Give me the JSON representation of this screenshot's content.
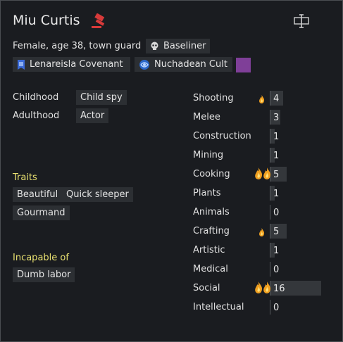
{
  "pawn": {
    "name": "Miu Curtis",
    "description": "Female, age 38, town guard",
    "xenotype": "Baseliner"
  },
  "factions": [
    {
      "label": "Lenareisla Covenant",
      "icon": "faction-banner-icon"
    },
    {
      "label": "Nuchadean Cult",
      "icon": "ideoligion-icon"
    }
  ],
  "ideo_color": "#7f3f98",
  "backstory": {
    "childhood_label": "Childhood",
    "childhood": "Child spy",
    "adulthood_label": "Adulthood",
    "adulthood": "Actor"
  },
  "traits": {
    "heading": "Traits",
    "items": [
      "Beautiful",
      "Quick sleeper",
      "Gourmand"
    ]
  },
  "incapable": {
    "heading": "Incapable of",
    "items": [
      "Dumb labor"
    ]
  },
  "skills": [
    {
      "name": "Shooting",
      "level": "4",
      "passion": 1,
      "fill": 0.2
    },
    {
      "name": "Melee",
      "level": "3",
      "passion": 0,
      "fill": 0.15
    },
    {
      "name": "Construction",
      "level": "1",
      "passion": 0,
      "fill": 0.05
    },
    {
      "name": "Mining",
      "level": "1",
      "passion": 0,
      "fill": 0.05
    },
    {
      "name": "Cooking",
      "level": "5",
      "passion": 2,
      "fill": 0.25
    },
    {
      "name": "Plants",
      "level": "1",
      "passion": 0,
      "fill": 0.05
    },
    {
      "name": "Animals",
      "level": "0",
      "passion": 0,
      "fill": 0
    },
    {
      "name": "Crafting",
      "level": "5",
      "passion": 1,
      "fill": 0.25
    },
    {
      "name": "Artistic",
      "level": "1",
      "passion": 0,
      "fill": 0.05
    },
    {
      "name": "Medical",
      "level": "0",
      "passion": 0,
      "fill": 0
    },
    {
      "name": "Social",
      "level": "16",
      "passion": 2,
      "fill": 0.8
    },
    {
      "name": "Intellectual",
      "level": "0",
      "passion": 0,
      "fill": 0
    }
  ],
  "colors": {
    "accent_section": "#e8e070",
    "gavel": "#d83a3a",
    "passion": "#f0a020"
  }
}
